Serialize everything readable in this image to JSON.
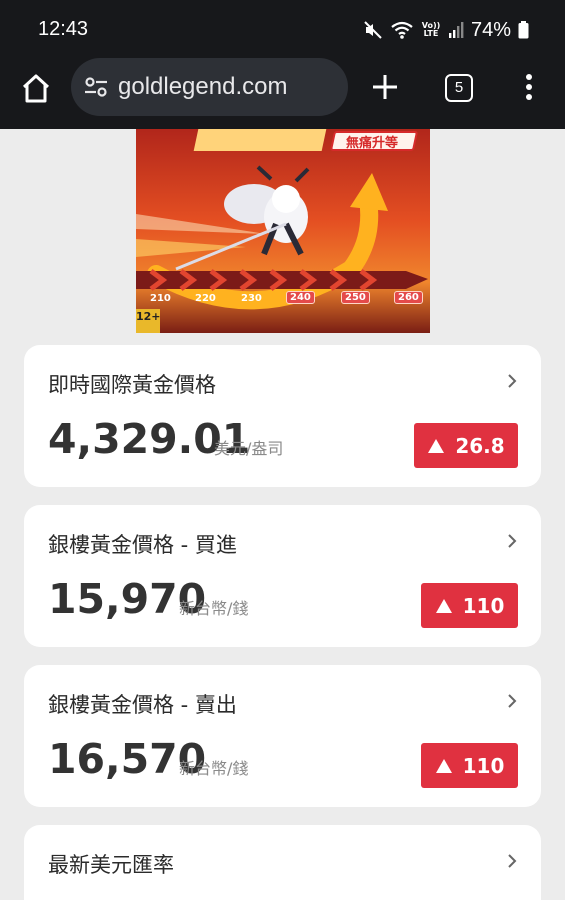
{
  "status_bar": {
    "time": "12:43",
    "network_label": "Vo)) LTE",
    "battery_percent": "74%"
  },
  "browser": {
    "url": "goldlegend.com",
    "tab_count": "5"
  },
  "banner": {
    "headline_badge": "無痛升等",
    "scale_marks": [
      "210",
      "220",
      "230",
      "240",
      "250",
      "260"
    ],
    "age_rating": "12+"
  },
  "cards": [
    {
      "title": "即時國際黃金價格",
      "price": "4,329.01",
      "unit": "美元/盎司",
      "change": "26.8"
    },
    {
      "title": "銀樓黃金價格 - 買進",
      "price": "15,970",
      "unit": "新台幣/錢",
      "change": "110"
    },
    {
      "title": "銀樓黃金價格 - 賣出",
      "price": "16,570",
      "unit": "新台幣/錢",
      "change": "110"
    },
    {
      "title": "最新美元匯率"
    }
  ],
  "colors": {
    "badge_up": "#e03140",
    "chrome_bar": "#17181b",
    "page_bg": "#ececec"
  }
}
